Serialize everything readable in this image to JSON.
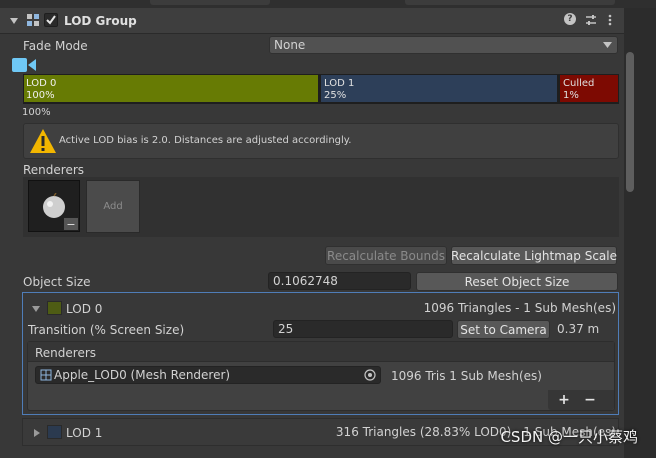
{
  "component": {
    "title": "LOD Group",
    "enabled": true
  },
  "header_icons": {
    "help": "help-icon",
    "presets": "presets-icon",
    "more": "more-icon"
  },
  "fade_mode": {
    "label": "Fade Mode",
    "value": "None"
  },
  "lod_bar": {
    "segments": [
      {
        "name": "LOD 0",
        "percent": "100%",
        "color": "#677b04"
      },
      {
        "name": "LOD 1",
        "percent": "25%",
        "color": "#2d3f59"
      },
      {
        "name": "Culled",
        "percent": "1%",
        "color": "#7d0a02"
      }
    ],
    "scale_label": "100%"
  },
  "warning": {
    "text": "Active LOD bias is 2.0. Distances are adjusted accordingly."
  },
  "renderers_section": {
    "label": "Renderers",
    "add_label": "Add",
    "remove_label": "−"
  },
  "buttons": {
    "recalc_bounds": "Recalculate Bounds",
    "recalc_lightmap": "Recalculate Lightmap Scale"
  },
  "object_size": {
    "label": "Object Size",
    "value": "0.1062748",
    "reset_label": "Reset Object Size"
  },
  "lod0": {
    "label": "LOD 0",
    "info": "1096 Triangles  - 1 Sub Mesh(es)",
    "transition_label": "Transition (% Screen Size)",
    "transition_value": "25",
    "set_camera_label": "Set to Camera",
    "distance": "0.37 m",
    "renderers_label": "Renderers",
    "renderer_name": "Apple_LOD0 (Mesh Renderer)",
    "renderer_info": "1096 Tris 1 Sub Mesh(es)",
    "add_label": "+",
    "remove_label": "−"
  },
  "lod1": {
    "label": "LOD 1",
    "info": "316 Triangles (28.83% LOD0) - 1 Sub Mesh(es)"
  },
  "watermark": "CSDN @一只小蔡鸡"
}
